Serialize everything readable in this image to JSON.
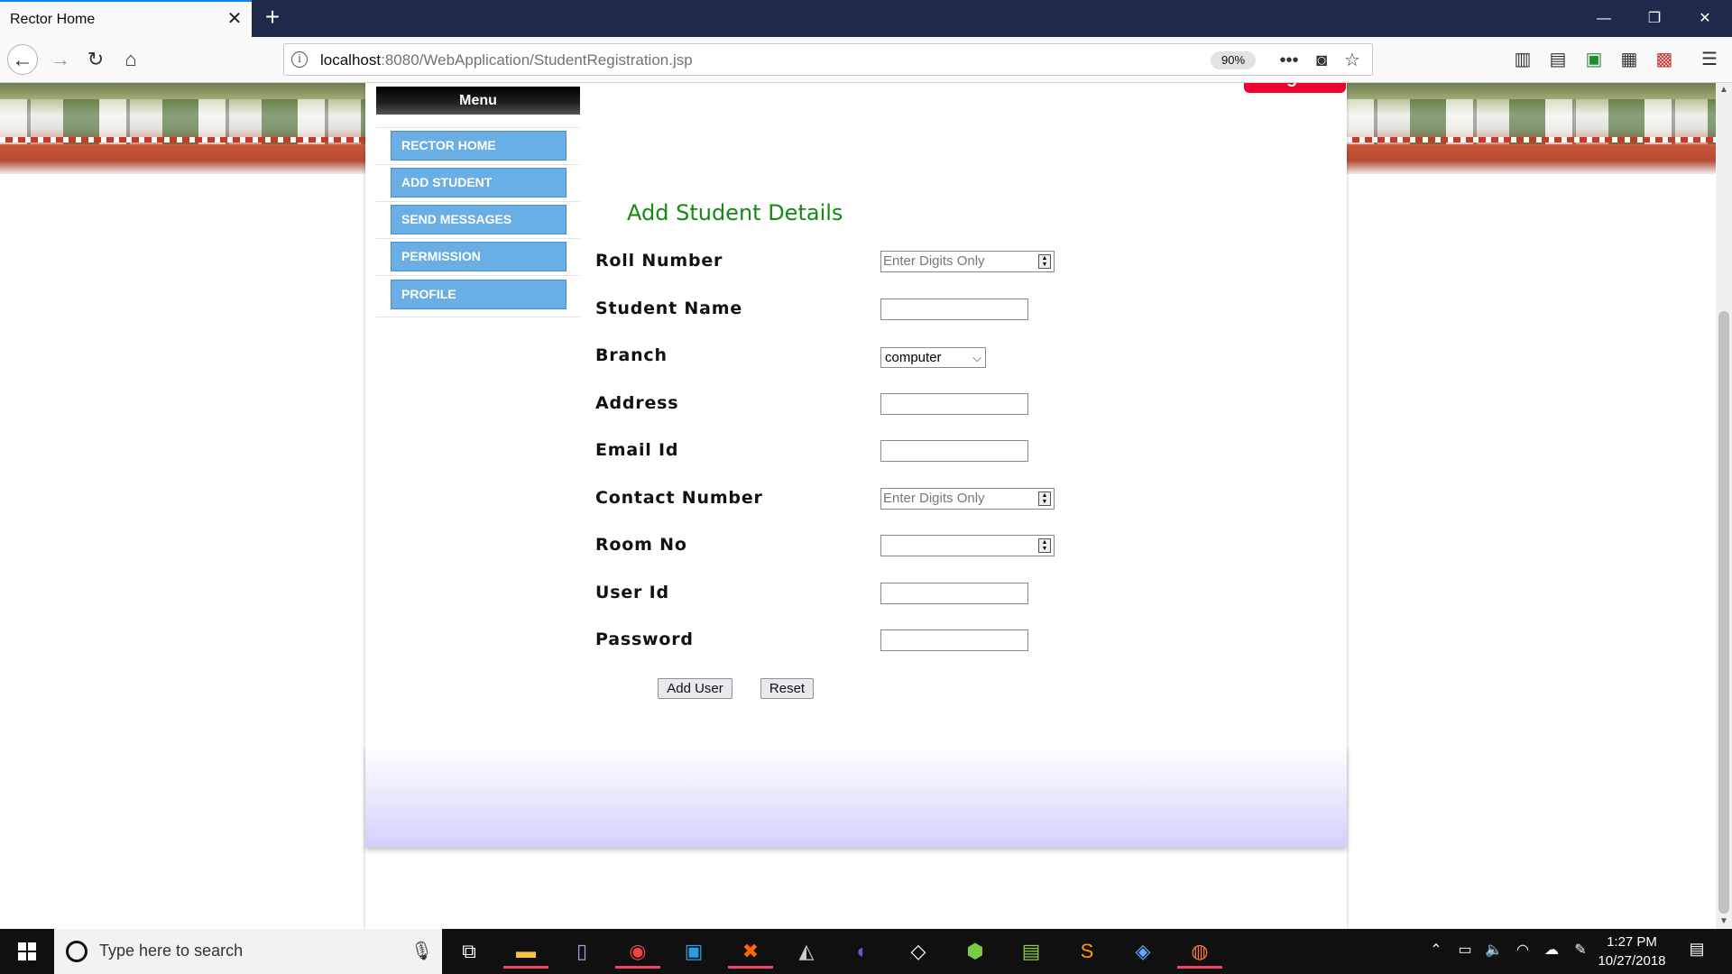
{
  "browser": {
    "tab_title": "Rector Home",
    "url_host": "localhost",
    "url_rest": ":8080/WebApplication/StudentRegistration.jsp",
    "zoom": "90%"
  },
  "menu": {
    "header": "Menu",
    "items": [
      {
        "label": "RECTOR HOME"
      },
      {
        "label": "ADD STUDENT"
      },
      {
        "label": "SEND MESSAGES"
      },
      {
        "label": "PERMISSION"
      },
      {
        "label": "PROFILE"
      }
    ]
  },
  "logout_label": "Logout",
  "form": {
    "title": "Add Student Details",
    "fields": {
      "roll_number": {
        "label": "Roll Number",
        "placeholder": "Enter Digits Only"
      },
      "student_name": {
        "label": "Student Name"
      },
      "branch": {
        "label": "Branch",
        "value": "computer"
      },
      "address": {
        "label": "Address"
      },
      "email_id": {
        "label": "Email Id"
      },
      "contact_number": {
        "label": "Contact Number",
        "placeholder": "Enter Digits Only"
      },
      "room_no": {
        "label": "Room No"
      },
      "user_id": {
        "label": "User Id"
      },
      "password": {
        "label": "Password"
      }
    },
    "add_user_label": "Add User",
    "reset_label": "Reset"
  },
  "taskbar": {
    "search_placeholder": "Type here to search",
    "time": "1:27 PM",
    "date": "10/27/2018"
  },
  "colors": {
    "menu_item_bg": "#6aaee6",
    "form_title": "#148a14",
    "logout_bg": "#f0002a",
    "titlebar_bg": "#1f2a4b"
  }
}
